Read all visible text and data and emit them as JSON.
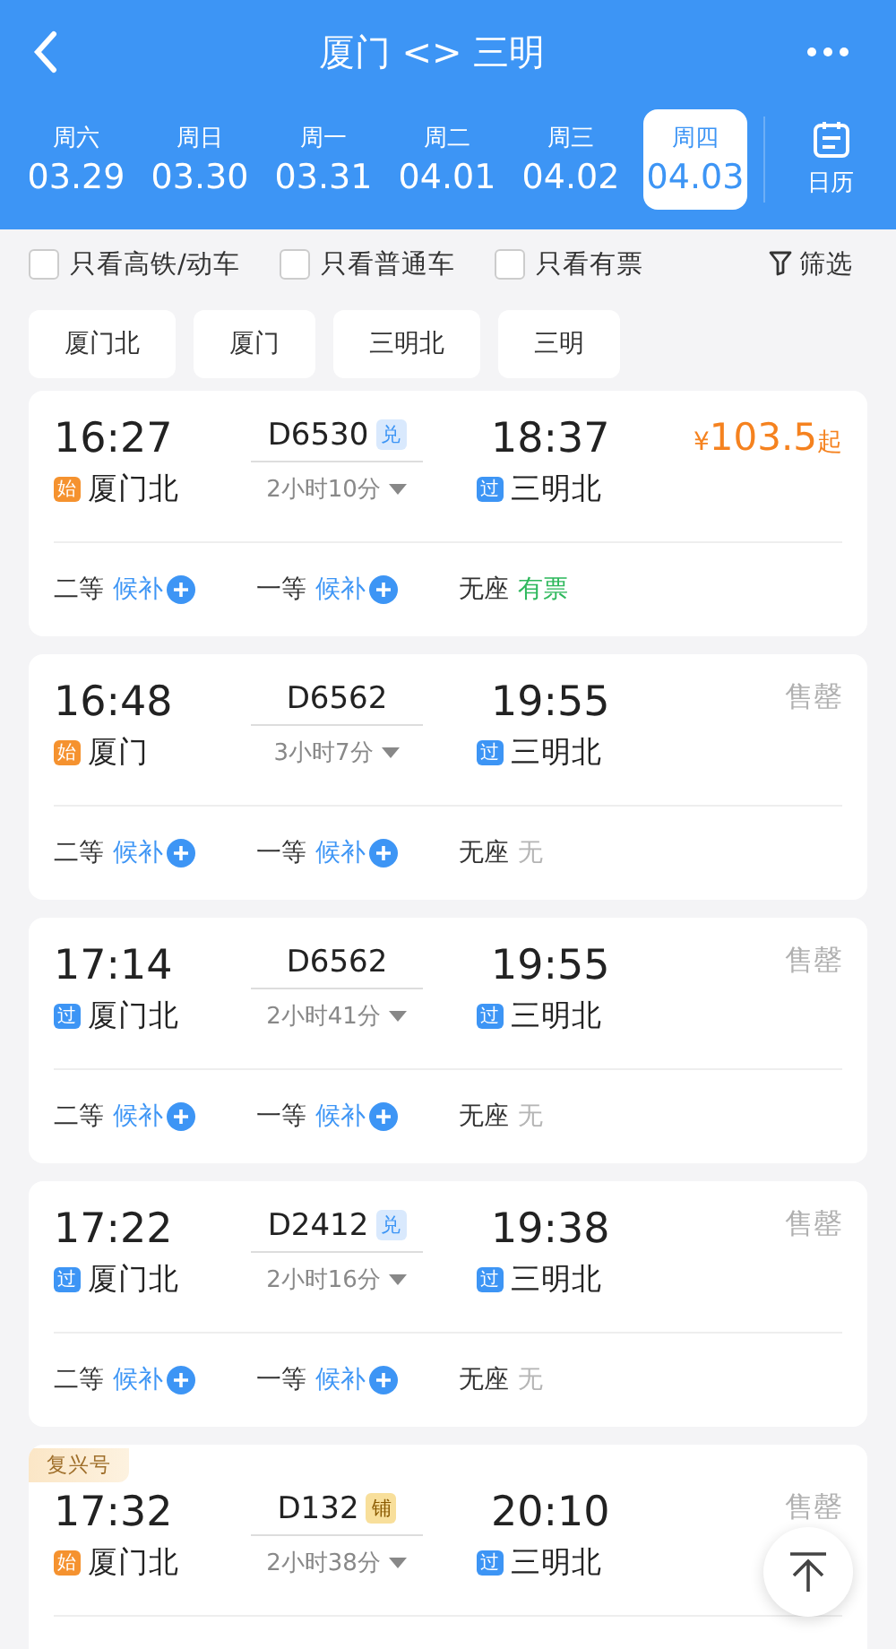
{
  "header": {
    "title": "厦门 <> 三明"
  },
  "dates": [
    {
      "weekday": "周六",
      "date": "03.29",
      "selected": false
    },
    {
      "weekday": "周日",
      "date": "03.30",
      "selected": false
    },
    {
      "weekday": "周一",
      "date": "03.31",
      "selected": false
    },
    {
      "weekday": "周二",
      "date": "04.01",
      "selected": false
    },
    {
      "weekday": "周三",
      "date": "04.02",
      "selected": false
    },
    {
      "weekday": "周四",
      "date": "04.03",
      "selected": true
    }
  ],
  "calendar_label": "日历",
  "filters": [
    {
      "label": "只看高铁/动车",
      "checked": false
    },
    {
      "label": "只看普通车",
      "checked": false
    },
    {
      "label": "只看有票",
      "checked": false
    }
  ],
  "filter_button": "筛选",
  "stations": [
    "厦门北",
    "厦门",
    "三明北",
    "三明"
  ],
  "trains": [
    {
      "depart": "16:27",
      "number": "D6530",
      "tag": {
        "kind": "exchange",
        "text": "兑"
      },
      "arrive": "18:37",
      "price": {
        "symbol": "¥",
        "amount": "103.5",
        "suffix": "起"
      },
      "from": {
        "kind": "start",
        "tag": "始",
        "name": "厦门北"
      },
      "duration": "2小时10分",
      "to": {
        "kind": "pass",
        "tag": "过",
        "name": "三明北"
      },
      "seats": [
        {
          "class": "二等",
          "status": "候补",
          "kind": "waitlist"
        },
        {
          "class": "一等",
          "status": "候补",
          "kind": "waitlist"
        },
        {
          "class": "无座",
          "status": "有票",
          "kind": "available"
        }
      ]
    },
    {
      "depart": "16:48",
      "number": "D6562",
      "arrive": "19:55",
      "status": "售罄",
      "from": {
        "kind": "start",
        "tag": "始",
        "name": "厦门"
      },
      "duration": "3小时7分",
      "to": {
        "kind": "pass",
        "tag": "过",
        "name": "三明北"
      },
      "seats": [
        {
          "class": "二等",
          "status": "候补",
          "kind": "waitlist"
        },
        {
          "class": "一等",
          "status": "候补",
          "kind": "waitlist"
        },
        {
          "class": "无座",
          "status": "无",
          "kind": "none"
        }
      ]
    },
    {
      "depart": "17:14",
      "number": "D6562",
      "arrive": "19:55",
      "status": "售罄",
      "from": {
        "kind": "pass",
        "tag": "过",
        "name": "厦门北"
      },
      "duration": "2小时41分",
      "to": {
        "kind": "pass",
        "tag": "过",
        "name": "三明北"
      },
      "seats": [
        {
          "class": "二等",
          "status": "候补",
          "kind": "waitlist"
        },
        {
          "class": "一等",
          "status": "候补",
          "kind": "waitlist"
        },
        {
          "class": "无座",
          "status": "无",
          "kind": "none"
        }
      ]
    },
    {
      "depart": "17:22",
      "number": "D2412",
      "tag": {
        "kind": "exchange",
        "text": "兑"
      },
      "arrive": "19:38",
      "status": "售罄",
      "from": {
        "kind": "pass",
        "tag": "过",
        "name": "厦门北"
      },
      "duration": "2小时16分",
      "to": {
        "kind": "pass",
        "tag": "过",
        "name": "三明北"
      },
      "seats": [
        {
          "class": "二等",
          "status": "候补",
          "kind": "waitlist"
        },
        {
          "class": "一等",
          "status": "候补",
          "kind": "waitlist"
        },
        {
          "class": "无座",
          "status": "无",
          "kind": "none"
        }
      ]
    },
    {
      "label": "复兴号",
      "depart": "17:32",
      "number": "D132",
      "tag": {
        "kind": "berth",
        "text": "铺"
      },
      "arrive": "20:10",
      "status": "售罄",
      "from": {
        "kind": "start",
        "tag": "始",
        "name": "厦门北"
      },
      "duration": "2小时38分",
      "to": {
        "kind": "pass",
        "tag": "过",
        "name": "三明北"
      }
    }
  ]
}
